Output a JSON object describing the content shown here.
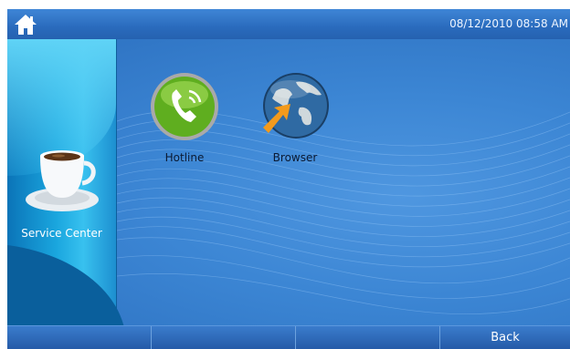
{
  "statusbar": {
    "home_icon": "home-icon",
    "datetime": "08/12/2010 08:58 AM"
  },
  "sidebar": {
    "icon": "coffee-cup-icon",
    "label": "Service Center"
  },
  "apps": [
    {
      "label": "Hotline",
      "icon": "phone-icon"
    },
    {
      "label": "Browser",
      "icon": "globe-icon"
    }
  ],
  "bottombar": {
    "buttons": [
      "",
      "",
      "",
      "Back"
    ]
  },
  "colors": {
    "background": "#2f74c2",
    "bar": "#2a6bbd",
    "sidebar_accent": "#1aa6de"
  }
}
